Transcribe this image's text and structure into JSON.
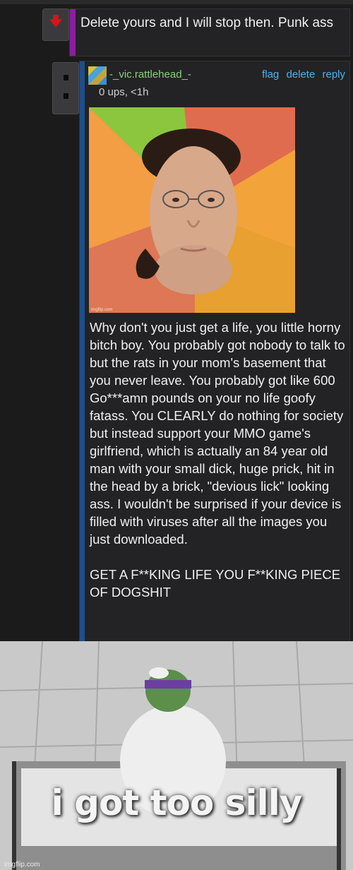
{
  "comment1": {
    "text": "Delete yours and I will stop then. Punk ass"
  },
  "comment2": {
    "username": "-_vic.rattlehead_-",
    "actions": {
      "flag": "flag",
      "delete": "delete",
      "reply": "reply"
    },
    "meta": "0 ups, <1h",
    "meme_watermark": "imgflip.com",
    "body": "Why don't you just get a life, you little horny bitch boy. You probably got nobody to talk to but the rats in your mom's basement that you never leave. You probably got like 600 Go***amn pounds on your no life goofy fatass. You CLEARLY do nothing for society but instead support your MMO game's girlfriend, which is actually an 84 year old man with your small dick, huge prick, hit in the head by a brick, \"devious lick\" looking ass. I wouldn't be surprised if your device is filled with viruses after all the images you just downloaded.\n\nGET A F**KING LIFE YOU F**KING PIECE OF DOGSHIT"
  },
  "bottom_meme": {
    "caption": "i got too silly",
    "watermark": "imgflip.com"
  },
  "colors": {
    "background": "#1b1b1c",
    "op_bar": "#8b1ea0",
    "reply_bar": "#1c4f8c",
    "link": "#4fb3ef",
    "username": "#8bd17a",
    "downvote": "#d8141a"
  }
}
